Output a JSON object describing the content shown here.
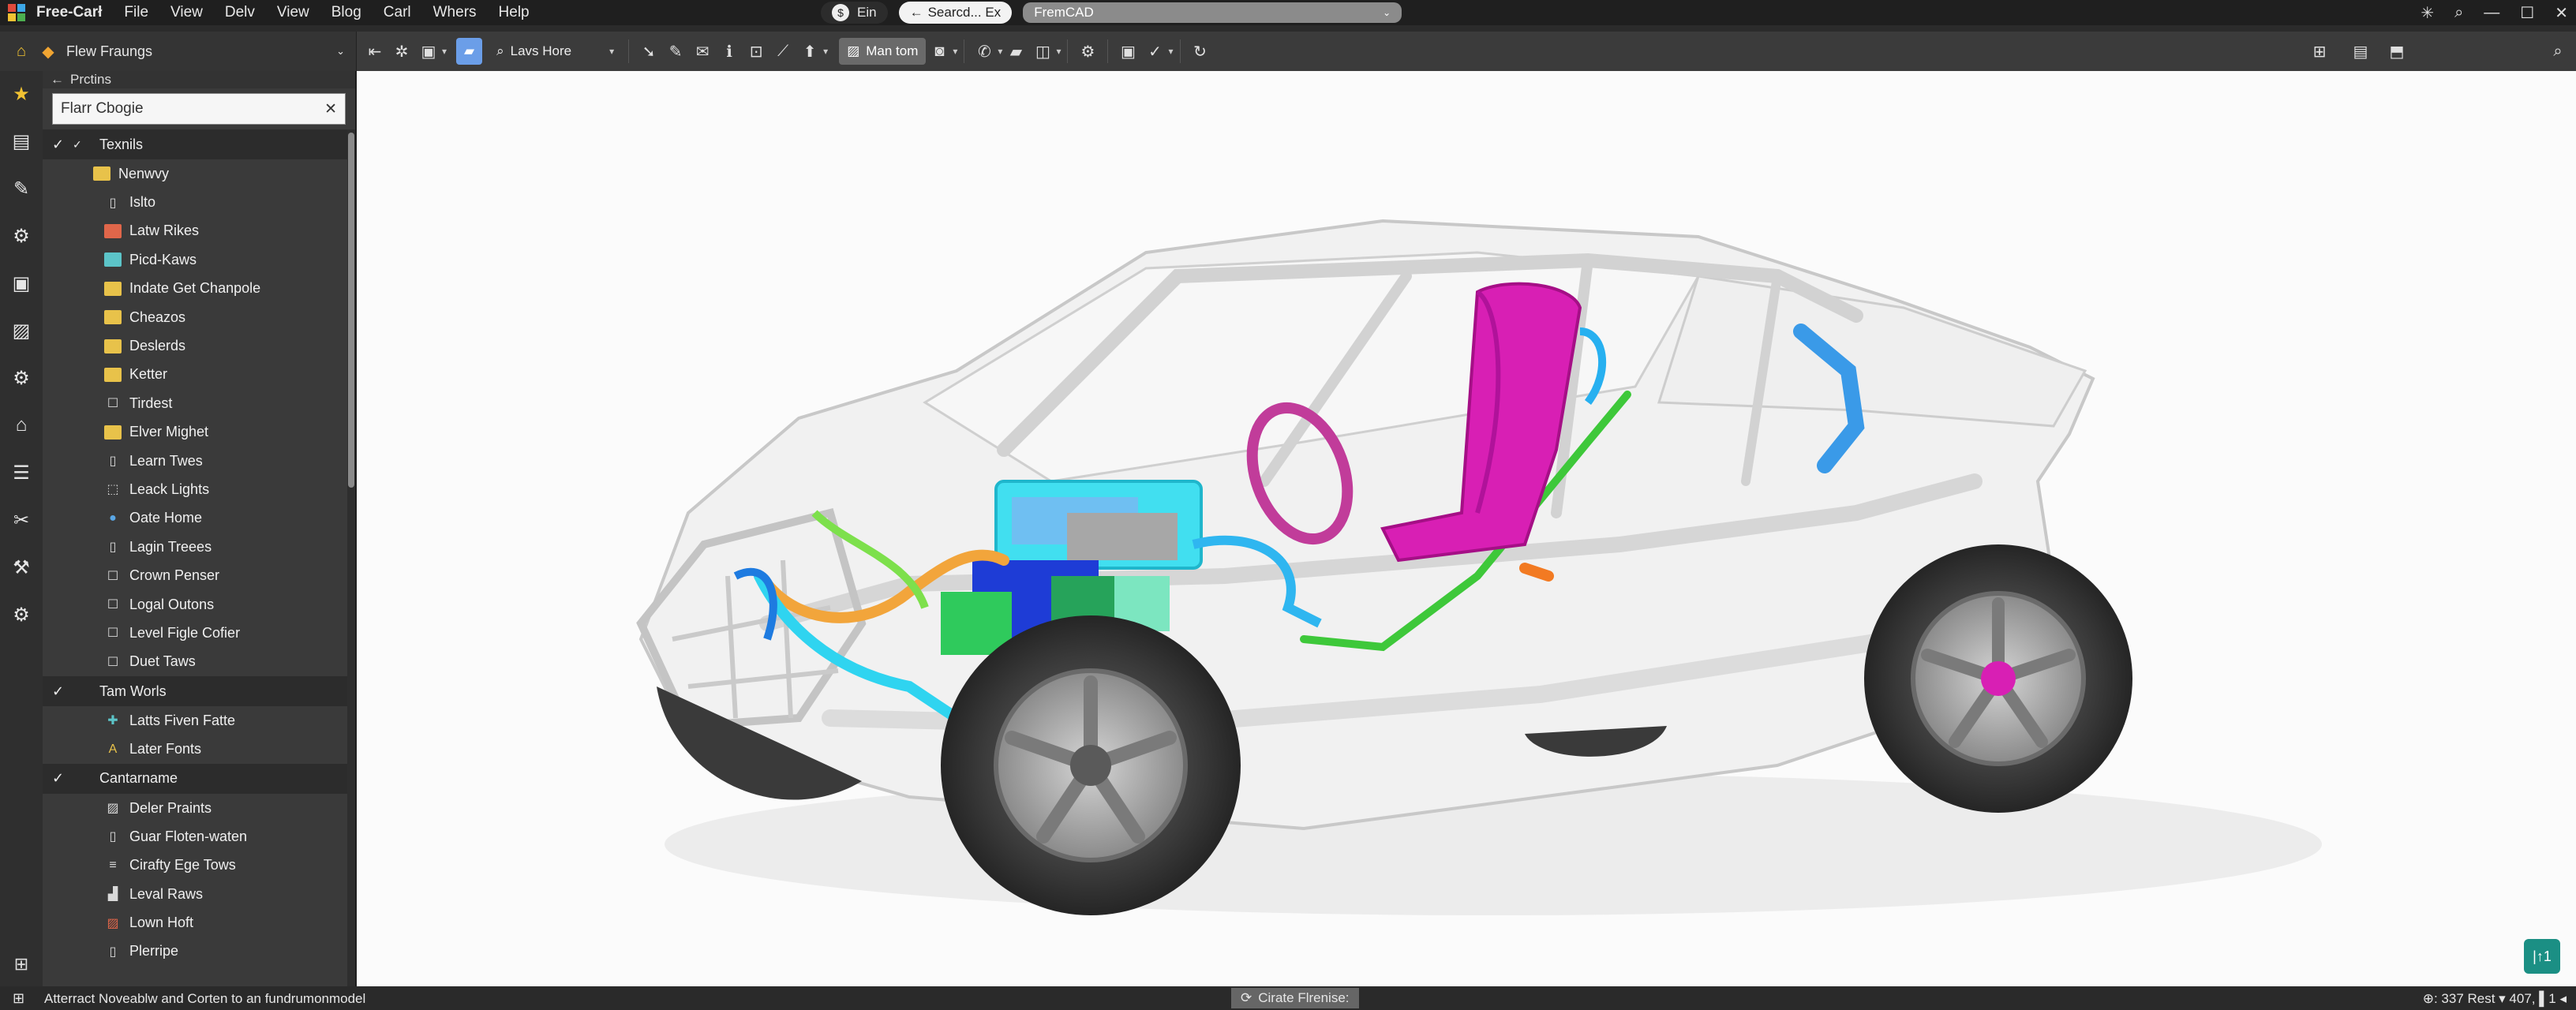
{
  "menubar": {
    "app_name": "Free-Carł",
    "items": [
      "File",
      "View",
      "Delv",
      "View",
      "Blog",
      "Carl",
      "Whers",
      "Help"
    ],
    "pill_1": "Ein",
    "pill_2": "Searcd... Ex",
    "pill_3": "FremCAD"
  },
  "toolbar": {
    "workbench_label": "Flew Fraungs",
    "view_label": "Lavs Hore",
    "mode_label": "Man tom"
  },
  "panel": {
    "header": "Prctins",
    "search_value": "Flarr Cbogie",
    "groups": [
      {
        "label": "Texnils",
        "items": [
          {
            "label": "Nenwvy",
            "icon": "folder-icon",
            "color": "#e8c24a",
            "indent": 1
          },
          {
            "label": "Islto",
            "icon": "page-icon",
            "color": "#d9d9d9",
            "indent": 2
          },
          {
            "label": "Latw Rikes",
            "icon": "folder-icon",
            "color": "#e0664a",
            "indent": 2
          },
          {
            "label": "Picd-Kaws",
            "icon": "folder-icon",
            "color": "#5cc4c8",
            "indent": 2
          },
          {
            "label": "Indate Get Chanpole",
            "icon": "folder-icon",
            "color": "#e8c24a",
            "indent": 2
          },
          {
            "label": "Cheazos",
            "icon": "folder-icon",
            "color": "#e8c24a",
            "indent": 2
          },
          {
            "label": "Deslerds",
            "icon": "folder-icon",
            "color": "#e8c24a",
            "indent": 2
          },
          {
            "label": "Ketter",
            "icon": "folder-icon",
            "color": "#e8c24a",
            "indent": 2
          },
          {
            "label": "Tirdest",
            "icon": "box-icon",
            "color": "#d9d9d9",
            "indent": 2
          },
          {
            "label": "Elver Mighet",
            "icon": "folder-icon",
            "color": "#e8c24a",
            "indent": 2
          },
          {
            "label": "Learn Twes",
            "icon": "page-icon",
            "color": "#d9d9d9",
            "indent": 2
          },
          {
            "label": "Leack Lights",
            "icon": "cube-icon",
            "color": "#d9d9d9",
            "indent": 2
          },
          {
            "label": "Oate Home",
            "icon": "globe-icon",
            "color": "#5aa7e6",
            "indent": 2
          },
          {
            "label": "Lagin Treees",
            "icon": "page-icon",
            "color": "#d9d9d9",
            "indent": 2
          },
          {
            "label": "Crown Penser",
            "icon": "box-icon",
            "color": "#d9d9d9",
            "indent": 2
          },
          {
            "label": "Logal Outons",
            "icon": "box-icon",
            "color": "#d9d9d9",
            "indent": 2
          },
          {
            "label": "Level Figle Cofier",
            "icon": "box-icon",
            "color": "#d9d9d9",
            "indent": 2
          },
          {
            "label": "Duet Taws",
            "icon": "box-icon",
            "color": "#d9d9d9",
            "indent": 2
          }
        ]
      },
      {
        "label": "Tam Worls",
        "items": [
          {
            "label": "Latts Fiven Fatte",
            "icon": "puzzle-icon",
            "color": "#5cc4c8",
            "indent": 2
          },
          {
            "label": "Later Fonts",
            "icon": "font-icon",
            "color": "#e8c24a",
            "indent": 2
          }
        ]
      },
      {
        "label": "Cantarname",
        "items": [
          {
            "label": "Deler Praints",
            "icon": "image-icon",
            "color": "#d9d9d9",
            "indent": 2
          },
          {
            "label": "Guar Floten-waten",
            "icon": "page-icon",
            "color": "#d9d9d9",
            "indent": 2
          },
          {
            "label": "Cirafty Ege Tows",
            "icon": "stack-icon",
            "color": "#d9d9d9",
            "indent": 2
          },
          {
            "label": "Leval Raws",
            "icon": "stairs-icon",
            "color": "#d9d9d9",
            "indent": 2
          },
          {
            "label": "Lown Hoft",
            "icon": "image-icon",
            "color": "#e0664a",
            "indent": 2
          },
          {
            "label": "Plerripe",
            "icon": "page-icon",
            "color": "#d9d9d9",
            "indent": 2
          }
        ]
      }
    ]
  },
  "viewport": {
    "nav_label": "|↑1"
  },
  "statusbar": {
    "left_text": "Atterract Noveablw and Corten to an fundrumonmodel",
    "center_text": "Cirate Flrenise:",
    "right_text": "⊕: 337 Rest  ▾ 407,  ▌1 ◂"
  },
  "colors": {
    "accent_blue": "#6b9ee8",
    "teal": "#1b8f84",
    "magenta": "#d81fb4",
    "cyan": "#3ad3f0",
    "green": "#3ec83a"
  }
}
